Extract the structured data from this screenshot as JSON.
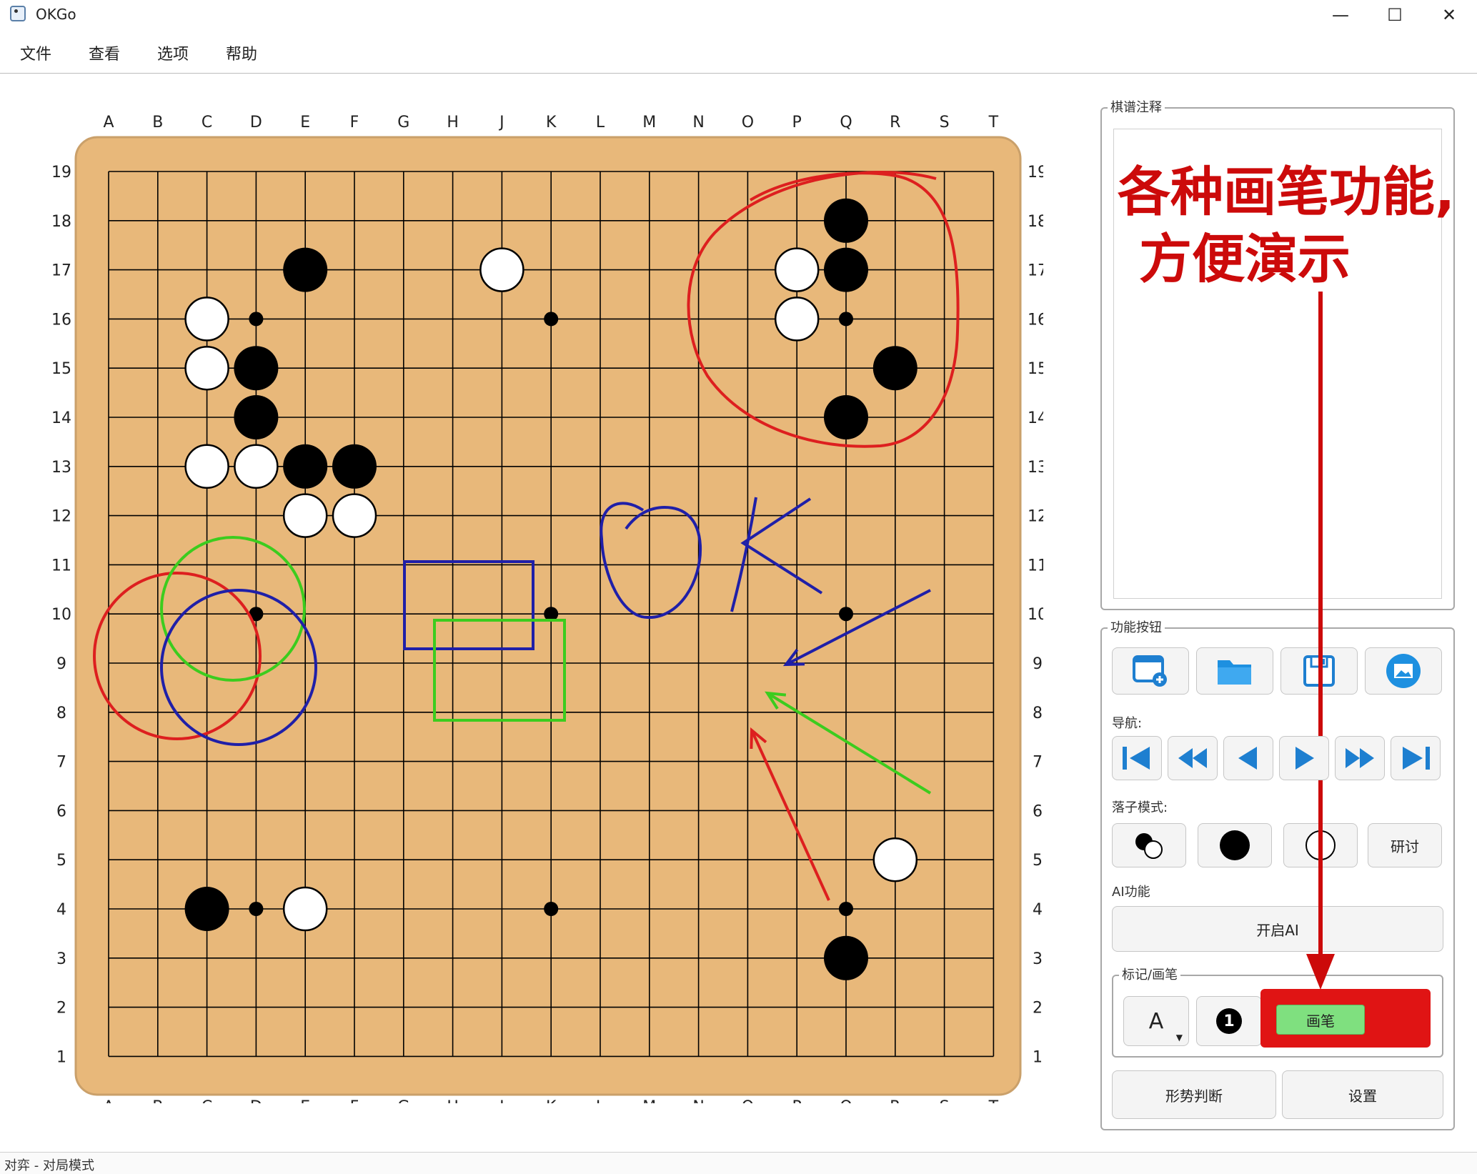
{
  "window": {
    "title": "OKGo",
    "minimize": "—",
    "maximize": "☐",
    "close": "✕"
  },
  "menu": [
    "文件",
    "查看",
    "选项",
    "帮助"
  ],
  "board": {
    "size": 19,
    "columns": [
      "A",
      "B",
      "C",
      "D",
      "E",
      "F",
      "G",
      "H",
      "J",
      "K",
      "L",
      "M",
      "N",
      "O",
      "P",
      "Q",
      "R",
      "S",
      "T"
    ],
    "rows": [
      "19",
      "18",
      "17",
      "16",
      "15",
      "14",
      "13",
      "12",
      "11",
      "10",
      "9",
      "8",
      "7",
      "6",
      "5",
      "4",
      "3",
      "2",
      "1"
    ],
    "colors": {
      "wood": "#e8b87a",
      "wood_border": "#caa06a",
      "line": "#000000"
    },
    "black_stones": [
      "E17",
      "D15",
      "D14",
      "E13",
      "F13",
      "Q18",
      "Q17",
      "R15",
      "Q14",
      "C4",
      "Q3"
    ],
    "white_stones": [
      "J17",
      "C16",
      "C15",
      "C13",
      "D13",
      "E12",
      "F12",
      "P17",
      "P16",
      "R5",
      "E4"
    ],
    "star_points": [
      "D16",
      "K16",
      "Q16",
      "D10",
      "K10",
      "Q10",
      "D4",
      "K4",
      "Q4"
    ]
  },
  "annotations": {
    "text": "OK",
    "colors": {
      "red": "#dd1f1f",
      "green": "#3ccc1e",
      "blue": "#1f1fa8"
    }
  },
  "panel": {
    "comment": {
      "title": "棋谱注释",
      "overlay_line1": "各种画笔功能,",
      "overlay_line2": "方便演示",
      "overlay_color": "#cc0a0a"
    },
    "functions": {
      "title": "功能按钮",
      "file_buttons": [
        {
          "name": "new-game",
          "icon": "new-board-icon"
        },
        {
          "name": "open",
          "icon": "folder-icon"
        },
        {
          "name": "save",
          "icon": "save-disk-icon"
        },
        {
          "name": "screenshot",
          "icon": "image-icon"
        }
      ],
      "nav_label": "导航:",
      "nav_buttons": [
        "first-move-icon",
        "back-fast-icon",
        "back-icon",
        "forward-icon",
        "forward-fast-icon",
        "last-move-icon"
      ],
      "play_mode_label": "落子模式:",
      "play_mode_buttons": [
        "alternate-stones-icon",
        "black-stone-icon",
        "white-stone-icon"
      ],
      "study_label": "研讨",
      "ai_label": "AI功能",
      "ai_button": "开启AI",
      "mark_title": "标记/画笔",
      "mark_letter": "A",
      "mark_number": "1",
      "pen_button": "画笔",
      "pen_colors": {
        "frame": "#e01414",
        "inner": "#7fe07f"
      },
      "judge_button": "形势判断",
      "settings_button": "设置"
    }
  },
  "status": "对弈 - 对局模式"
}
